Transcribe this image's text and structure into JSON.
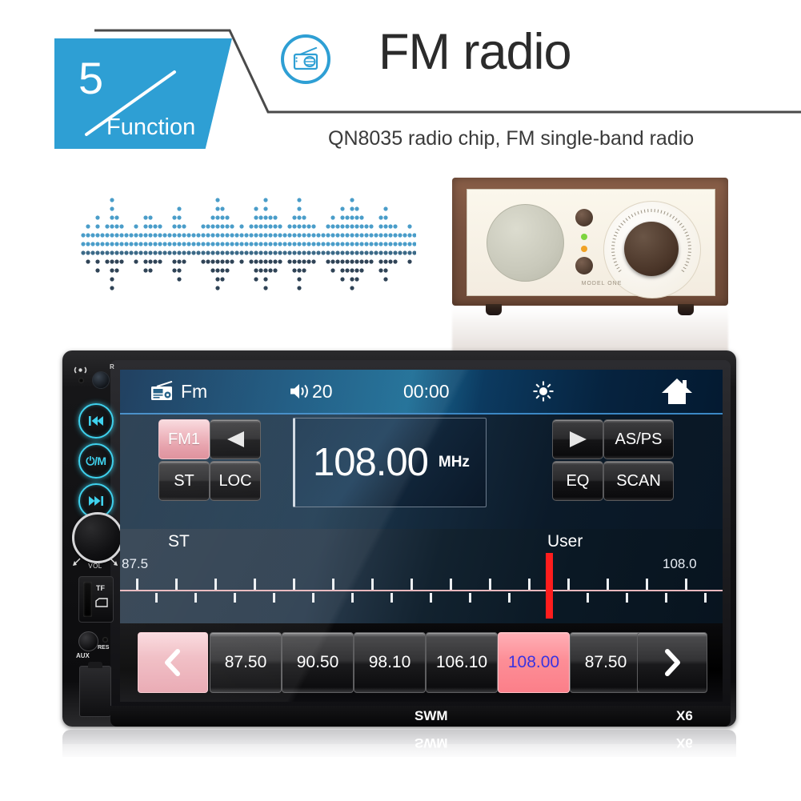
{
  "header": {
    "badge_number": "5",
    "badge_label": "Function",
    "icon": "radio-icon",
    "title": "FM radio",
    "subtitle": "QN8035 radio chip, FM single-band radio",
    "accent_color": "#2e9fd4",
    "rule_color": "#4a4a4a"
  },
  "waveform": {
    "name": "audio-waveform-graphic",
    "color_light": "#4a9dc9",
    "color_dark": "#2f4356"
  },
  "vintage_radio": {
    "name": "vintage-tabletop-radio-photo",
    "model_text": "MODEL ONE",
    "wood_color": "#7a5340",
    "face_color": "#f8f3e6"
  },
  "stereo": {
    "left_panel": {
      "mic_icon": "microphone-icon",
      "ir_label": "R",
      "buttons": [
        {
          "name": "prev-track-button",
          "glyph": "⏮"
        },
        {
          "name": "power-mode-button",
          "glyph": "⏻/M"
        },
        {
          "name": "next-track-button",
          "glyph": "⏭"
        }
      ],
      "volume_label": "VOL",
      "tf_label": "TF",
      "aux_label": "AUX",
      "res_label": "RES",
      "accent_glow": "#3fd2ee"
    },
    "screen": {
      "topbar": {
        "source_icon": "radio-icon",
        "source_label": "Fm",
        "volume_icon": "speaker-icon",
        "volume_value": "20",
        "clock": "00:00",
        "brightness_icon": "sun-icon",
        "home_icon": "home-icon"
      },
      "controls_left": [
        {
          "name": "fm1-band-button",
          "label": "FM1",
          "state": "active"
        },
        {
          "name": "tune-down-button",
          "label": "◀",
          "state": "normal"
        },
        {
          "name": "stereo-button",
          "label": "ST",
          "state": "normal"
        },
        {
          "name": "local-button",
          "label": "LOC",
          "state": "normal"
        }
      ],
      "frequency": {
        "value": "108.00",
        "unit": "MHz"
      },
      "controls_right": [
        {
          "name": "tune-up-button",
          "label": "▶",
          "state": "normal"
        },
        {
          "name": "auto-store-preset-scan-button",
          "label": "AS/PS",
          "state": "normal"
        },
        {
          "name": "eq-button",
          "label": "EQ",
          "state": "normal"
        },
        {
          "name": "scan-button",
          "label": "SCAN",
          "state": "normal"
        }
      ],
      "scale": {
        "stereo_label": "ST",
        "user_label": "User",
        "min_label": "87.5",
        "max_label": "108.0",
        "needle_color": "#ff1d1d",
        "needle_frequency": "108.00",
        "line_color": "#e8b7bc"
      },
      "presets": {
        "prev_button": "‹",
        "next_button": "›",
        "items": [
          {
            "label": "87.50",
            "active": false
          },
          {
            "label": "90.50",
            "active": false
          },
          {
            "label": "98.10",
            "active": false
          },
          {
            "label": "106.10",
            "active": false
          },
          {
            "label": "108.00",
            "active": true
          },
          {
            "label": "87.50",
            "active": false
          }
        ],
        "active_bg": "#fb7f89",
        "active_fg": "#3a33e0",
        "nav_bg": "#efb7bf"
      }
    },
    "bottom_labels": {
      "left": "SWM",
      "right": "X6"
    }
  }
}
